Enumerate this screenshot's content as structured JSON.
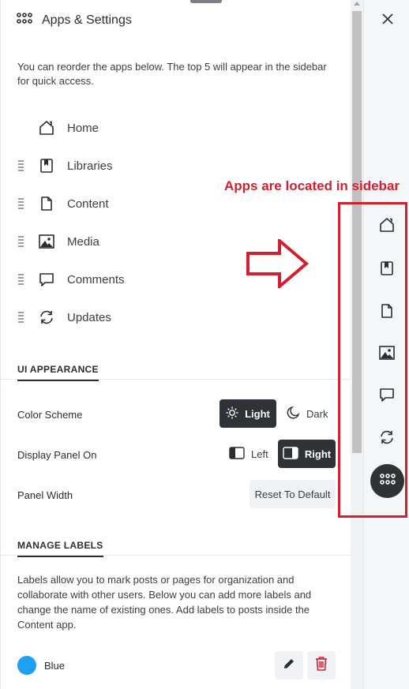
{
  "header": {
    "title": "Apps & Settings",
    "icon": "apps-grid-icon"
  },
  "intro": "You can reorder the apps below. The top 5 will appear in the sidebar for quick access.",
  "apps": [
    {
      "label": "Home",
      "icon": "home-icon",
      "draggable": false
    },
    {
      "label": "Libraries",
      "icon": "libraries-icon",
      "draggable": true
    },
    {
      "label": "Content",
      "icon": "content-icon",
      "draggable": true
    },
    {
      "label": "Media",
      "icon": "media-icon",
      "draggable": true
    },
    {
      "label": "Comments",
      "icon": "comments-icon",
      "draggable": true
    },
    {
      "label": "Updates",
      "icon": "updates-icon",
      "draggable": true
    }
  ],
  "ui_appearance": {
    "title": "UI APPEARANCE",
    "color_scheme": {
      "label": "Color Scheme",
      "light": "Light",
      "dark": "Dark",
      "selected": "Light"
    },
    "display_panel": {
      "label": "Display Panel On",
      "left": "Left",
      "right": "Right",
      "selected": "Right"
    },
    "panel_width": {
      "label": "Panel Width",
      "reset": "Reset To Default"
    }
  },
  "manage_labels": {
    "title": "MANAGE LABELS",
    "description": "Labels allow you to mark posts or pages for organization and collaborate with other users. Below you can add more labels and change the name of existing ones. Add labels to posts inside the Content app.",
    "labels": [
      {
        "name": "Blue",
        "color": "#1da1f2"
      }
    ]
  },
  "annotation": {
    "text": "Apps are located in sidebar",
    "color": "#d32030"
  },
  "colors": {
    "dark_button": "#2f3237",
    "accent_red": "#d32030",
    "label_blue": "#1da1f2"
  }
}
